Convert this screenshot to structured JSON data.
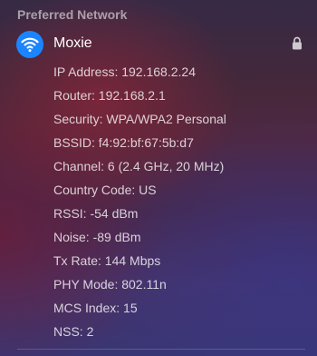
{
  "section": {
    "title": "Preferred Network"
  },
  "network": {
    "name": "Moxie",
    "icon": "wifi-icon",
    "badge_color": "#1b84ff",
    "secured_icon": "lock-icon"
  },
  "details": [
    "IP Address: 192.168.2.24",
    "Router: 192.168.2.1",
    "Security: WPA/WPA2 Personal",
    "BSSID: f4:92:bf:67:5b:d7",
    "Channel: 6 (2.4 GHz, 20 MHz)",
    "Country Code: US",
    "RSSI: -54 dBm",
    "Noise: -89 dBm",
    "Tx Rate: 144 Mbps",
    "PHY Mode: 802.11n",
    "MCS Index: 15",
    "NSS: 2"
  ]
}
